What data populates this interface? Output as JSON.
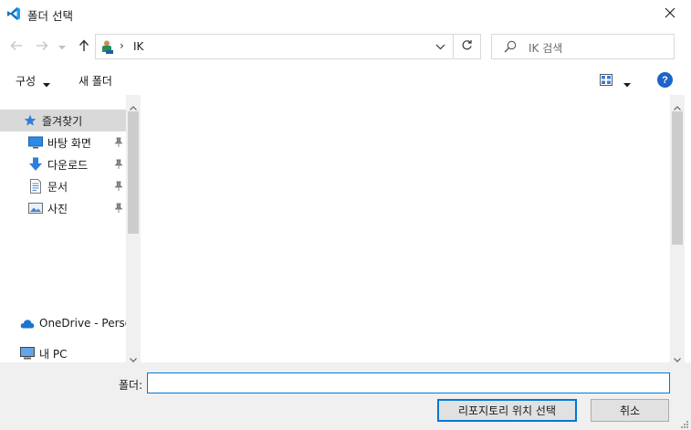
{
  "window": {
    "title": "폴더 선택",
    "app_icon": "vscode-icon",
    "close_icon": "close-icon"
  },
  "navigation": {
    "back_icon": "arrow-left-icon",
    "forward_icon": "arrow-right-icon",
    "recent_icon": "chevron-down-icon",
    "up_icon": "arrow-up-icon",
    "address": {
      "location_icon": "user-folder-icon",
      "separator": "›",
      "path": "IK"
    },
    "refresh_icon": "refresh-icon",
    "search_placeholder": "IK 검색"
  },
  "toolbar": {
    "organize_label": "구성",
    "new_folder_label": "새 폴더",
    "view_icon": "view-options-icon",
    "help_label": "?"
  },
  "sidebar": {
    "items": [
      {
        "label": "즐겨찾기",
        "icon": "star-icon",
        "selected": true,
        "pinned": false
      },
      {
        "label": "바탕 화면",
        "icon": "desktop-icon",
        "selected": false,
        "pinned": true
      },
      {
        "label": "다운로드",
        "icon": "download-icon",
        "selected": false,
        "pinned": true
      },
      {
        "label": "문서",
        "icon": "document-icon",
        "selected": false,
        "pinned": true
      },
      {
        "label": "사진",
        "icon": "picture-icon",
        "selected": false,
        "pinned": true
      },
      {
        "label": "OneDrive - Persor",
        "icon": "cloud-icon",
        "selected": false,
        "pinned": false
      },
      {
        "label": "내 PC",
        "icon": "computer-icon",
        "selected": false,
        "pinned": false
      }
    ]
  },
  "footer": {
    "folder_label": "폴더:",
    "folder_value": "",
    "select_button": "리포지토리 위치 선택",
    "cancel_button": "취소"
  },
  "colors": {
    "accent": "#0078d7",
    "selection": "#d9d9d9",
    "footer_bg": "#f0f0f0"
  }
}
